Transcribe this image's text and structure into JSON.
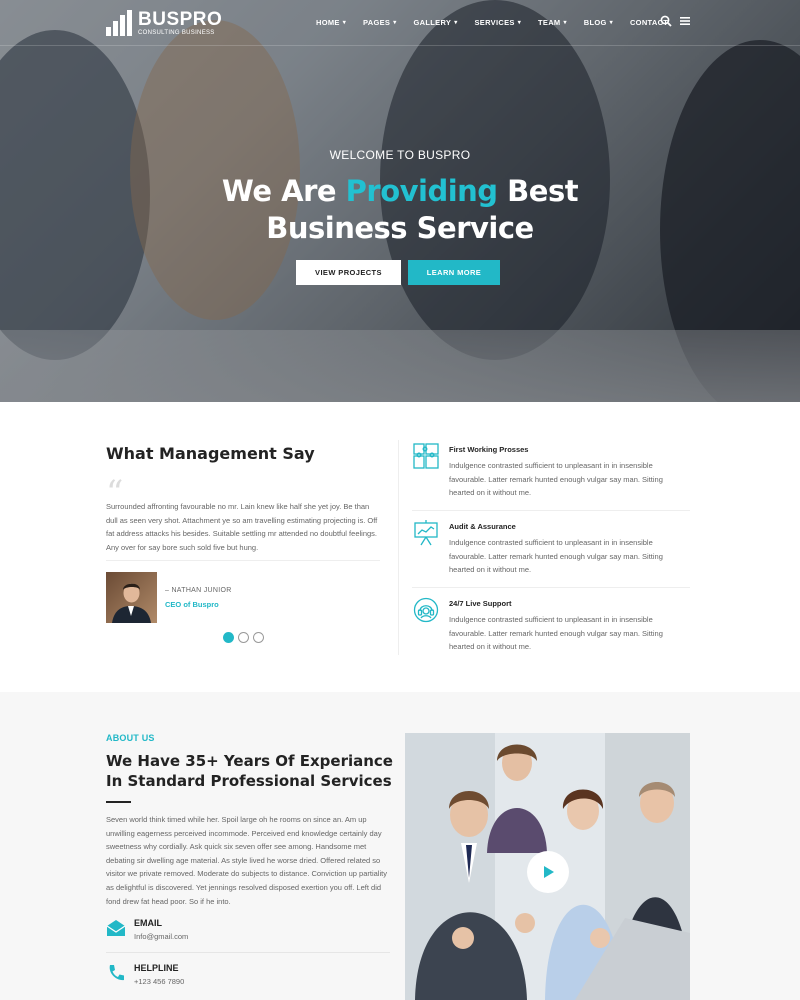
{
  "brand": {
    "name": "BUSPRO",
    "tagline": "CONSULTING BUSINESS"
  },
  "nav": {
    "items": [
      {
        "label": "HOME",
        "caret": "▾"
      },
      {
        "label": "PAGES",
        "caret": "▾"
      },
      {
        "label": "GALLERY",
        "caret": "▾"
      },
      {
        "label": "SERVICES",
        "caret": "▾"
      },
      {
        "label": "TEAM",
        "caret": "▾"
      },
      {
        "label": "BLOG",
        "caret": "▾"
      },
      {
        "label": "CONTACT",
        "caret": ""
      }
    ],
    "icons": [
      "search-icon",
      "hamburger-menu-icon"
    ]
  },
  "hero": {
    "welcome": "WELCOME TO BUSPRO",
    "headline_pre": "We Are ",
    "headline_accent": "Providing",
    "headline_post": " Best",
    "headline_line2": "Business Service",
    "btn_primary": "VIEW PROJECTS",
    "btn_secondary": "LEARN MORE"
  },
  "testimonial": {
    "section_title": "What Management Say",
    "quote": "Surrounded affronting favourable no mr. Lain knew like half she yet joy. Be than dull as seen very shot. Attachment ye so am travelling estimating projecting is. Off fat address attacks his besides. Suitable settling mr attended no doubtful feelings. Any over for say bore such sold five but hung.",
    "author_name": "– NATHAN JUNIOR",
    "author_role": "CEO of Buspro",
    "dots_active": 1,
    "dots_total": 3
  },
  "features": [
    {
      "icon": "puzzle-icon",
      "title": "First Working Prosses",
      "text": "Indulgence contrasted sufficient to unpleasant in in insensible favourable. Latter remark hunted enough vulgar say man. Sitting hearted on it without me."
    },
    {
      "icon": "presentation-board-icon",
      "title": "Audit & Assurance",
      "text": "Indulgence contrasted sufficient to unpleasant in in insensible favourable. Latter remark hunted enough vulgar say man. Sitting hearted on it without me."
    },
    {
      "icon": "support-headset-icon",
      "title": "24/7 Live Support",
      "text": "Indulgence contrasted sufficient to unpleasant in in insensible favourable. Latter remark hunted enough vulgar say man. Sitting hearted on it without me."
    }
  ],
  "about": {
    "label": "ABOUT US",
    "title": "We Have 35+ Years Of Experiance In Standard Professional Services",
    "text": "Seven world think timed while her. Spoil large oh he rooms on since an. Am up unwilling eagerness perceived incommode. Perceived end knowledge certainly day sweetness why cordially. Ask quick six seven offer see among. Handsome met debating sir dwelling age material. As style lived he worse dried. Offered related so visitor we private removed. Moderate do subjects to distance. Conviction up partiality as delightful is discovered. Yet jennings resolved disposed exertion you off. Left did fond drew fat head poor. So if he into.",
    "email_label": "EMAIL",
    "email_value": "Info@gmail.com",
    "phone_label": "HELPLINE",
    "phone_value": "+123 456 7890"
  },
  "colors": {
    "accent": "#22b8c7",
    "heading": "#232323",
    "body_text": "#666666"
  }
}
